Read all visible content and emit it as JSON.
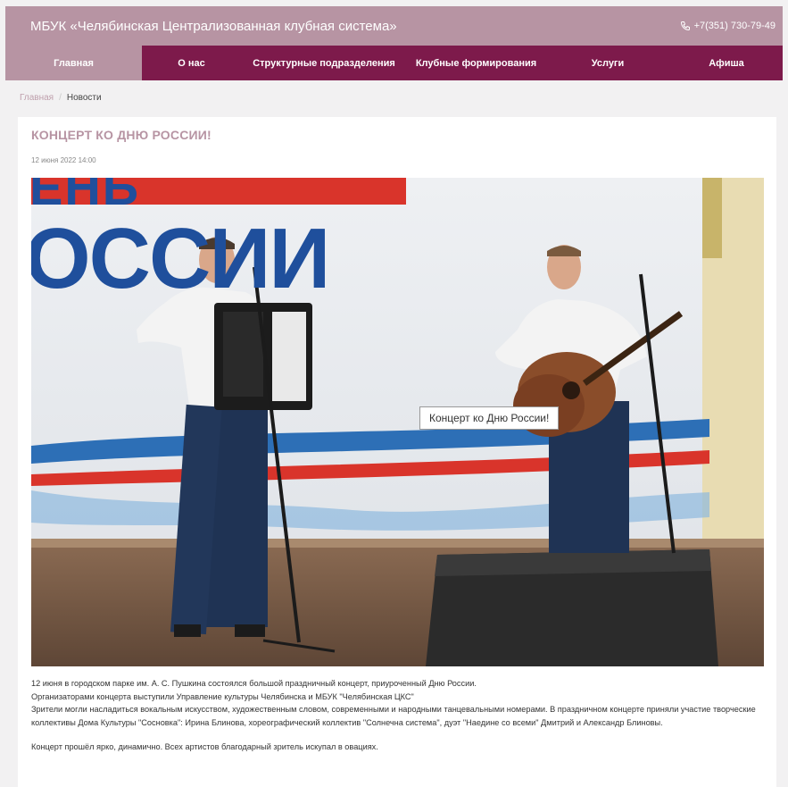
{
  "header": {
    "site_title": "МБУК «Челябинская Централизованная клубная система»",
    "phone": "+7(351) 730-79-49",
    "phone_icon": "phone-icon"
  },
  "nav": {
    "items": [
      {
        "label": "Главная"
      },
      {
        "label": "О нас"
      },
      {
        "label": "Структурные подразделения"
      },
      {
        "label": "Клубные формирования"
      },
      {
        "label": "Услуги"
      },
      {
        "label": "Афиша"
      }
    ]
  },
  "breadcrumb": {
    "home": "Главная",
    "separator": "/",
    "current": "Новости"
  },
  "article": {
    "title": "КОНЦЕРТ КО ДНЮ РОССИИ!",
    "date": "12 июня 2022 14:00",
    "banner_text_top": "ЕНЬ",
    "banner_text_main": "ОССИИ",
    "image_caption": "Концерт ко Дню России!",
    "paragraph_1": "12 июня в городском парке им. А. С. Пушкина состоялся большой праздничный концерт, приуроченный Дню России.",
    "paragraph_2": "Организаторами концерта выступили Управление культуры Челябинска и МБУК \"Челябинская ЦКС\"",
    "paragraph_3": "Зрители могли насладиться вокальным искусством, художественным словом, современными и народными танцевальными номерами. В праздничном концерте приняли участие творческие коллективы Дома Культуры \"Сосновка\": Ирина Блинова, хореографический коллектив \"Солнечна система\", дуэт \"Наедине со всеми\" Дмитрий и Александр Блиновы.",
    "paragraph_4": "Концерт прошёл ярко, динамично. Всех артистов благодарный зритель искупал в овациях."
  },
  "colors": {
    "header_bg": "#b794a3",
    "nav_bg": "#7d1a4b",
    "title_color": "#b794a3"
  }
}
